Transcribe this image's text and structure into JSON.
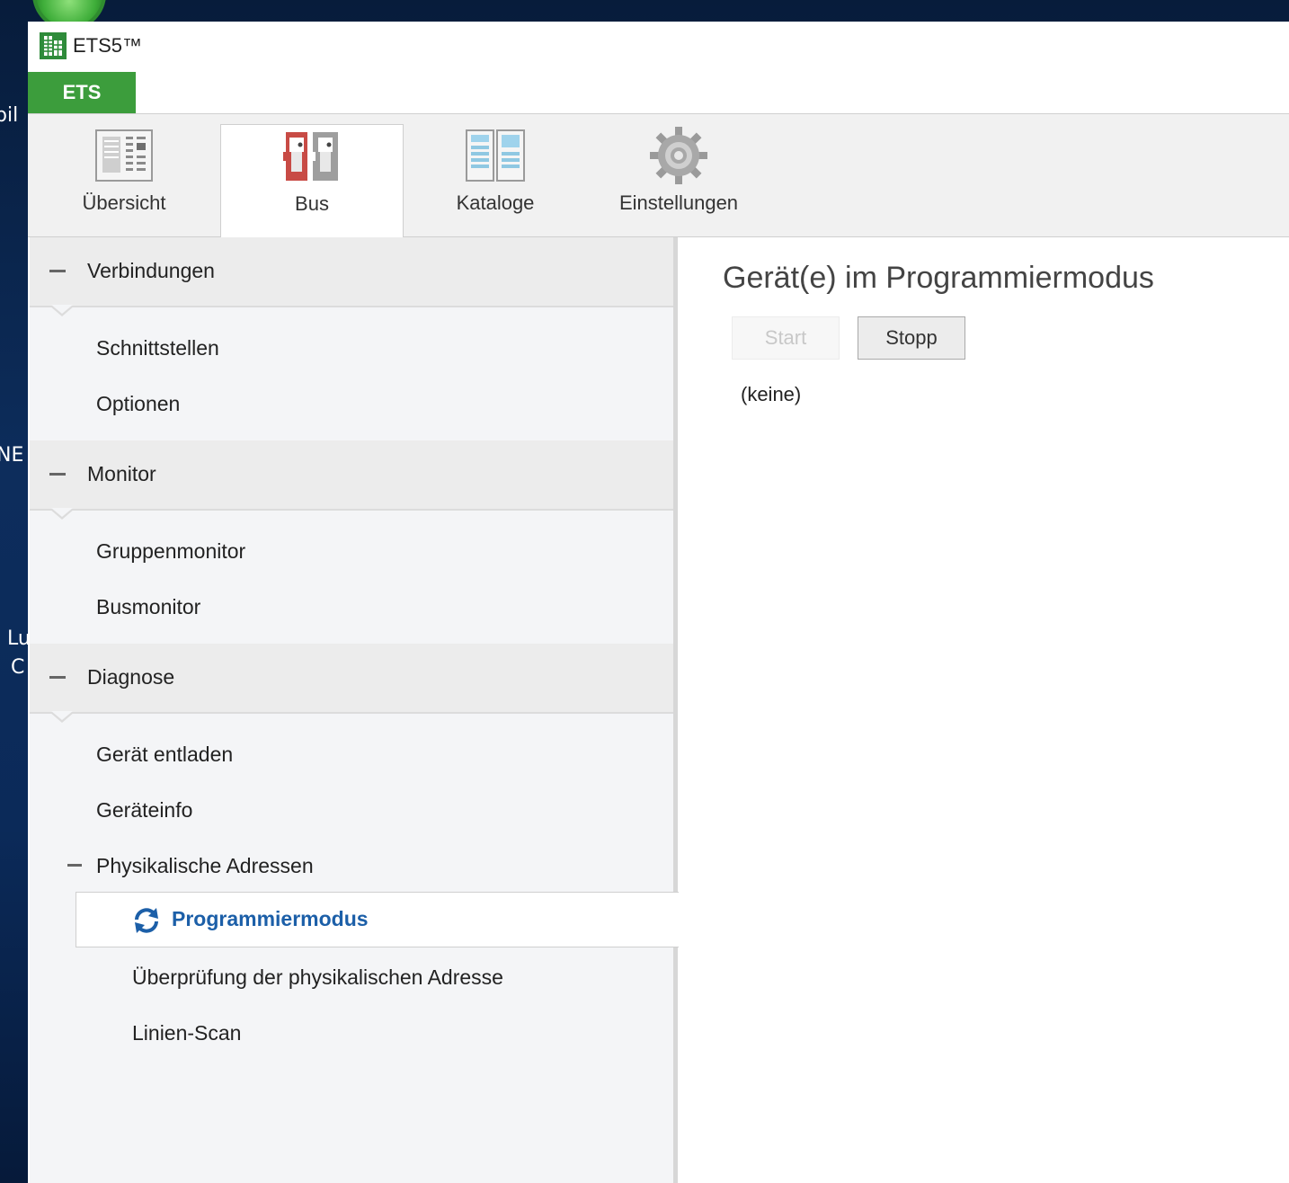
{
  "desktop": {
    "fragments": [
      "bil",
      "NE",
      "Lu",
      "C"
    ]
  },
  "window": {
    "title": "ETS5™",
    "menu_label": "ETS"
  },
  "ribbon": {
    "tabs": [
      {
        "label": "Übersicht",
        "icon": "overview-icon"
      },
      {
        "label": "Bus",
        "icon": "bus-icon",
        "active": true
      },
      {
        "label": "Kataloge",
        "icon": "catalogs-icon"
      },
      {
        "label": "Einstellungen",
        "icon": "gear-icon"
      }
    ]
  },
  "nav": {
    "groups": [
      {
        "label": "Verbindungen",
        "items": [
          "Schnittstellen",
          "Optionen"
        ]
      },
      {
        "label": "Monitor",
        "items": [
          "Gruppenmonitor",
          "Busmonitor"
        ]
      },
      {
        "label": "Diagnose",
        "items": [
          "Gerät entladen",
          "Geräteinfo"
        ]
      }
    ],
    "subgroup": {
      "label": "Physikalische Adressen",
      "items": [
        "Programmiermodus",
        "Überprüfung der physikalischen Adresse",
        "Linien-Scan"
      ],
      "selected": "Programmiermodus"
    }
  },
  "content": {
    "title": "Gerät(e) im Programmiermodus",
    "start_label": "Start",
    "stop_label": "Stopp",
    "empty_text": "(keine)"
  },
  "colors": {
    "accent_green": "#3c9d3c",
    "selected_blue": "#1c5fa8"
  }
}
